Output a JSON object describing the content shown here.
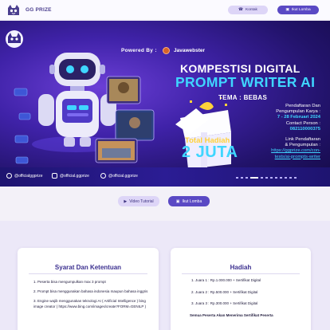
{
  "header": {
    "brand": "GG PRIZE",
    "contact_label": "Kontak",
    "join_label": "Ikut Lomba"
  },
  "banner": {
    "powered_by": "Powered By :",
    "sponsor": "Javawebster",
    "title_line1": "KOMPESTISI DIGITAL",
    "title_line2": "PROMPT WRITER AI",
    "theme": "TEMA : BEBAS",
    "registration_label_1": "Pendaftaran Dan",
    "registration_label_2": "Pengumpulan Karya :",
    "registration_date": "7 - 28 Februari 2024",
    "contact_label": "Contact Person :",
    "contact_number": "082110000375",
    "link_label_1": "Link Pendaftaran",
    "link_label_2": "& Pengumpulan :",
    "link_1": "https://ggprize.com/con-",
    "link_2": "tests/ai-prompts-writer",
    "prize_label": "Total Hadiah",
    "prize_value": "2 JUTA",
    "socials": [
      "@officialggprize",
      "@official.ggprize",
      "@official.ggprize"
    ]
  },
  "actions": {
    "video_label": "Video Tutorial",
    "join_label": "Ikut Lomba"
  },
  "rules_card": {
    "title": "Syarat Dan Ketentuan",
    "items": [
      "1.  Peserta bisa mengumpulkan max 3 prompt",
      "2.  Prompt bisa menggunakan bahasa indonesia maupun bahasa inggris",
      "3.  Engine wajib menggunakan teknologi AI ( Artificial Intelligence ) bing image creator ( https://www.bing.com/images/create?FORM=GENILP )"
    ]
  },
  "prize_card": {
    "title": "Hadiah",
    "items": [
      "1.  Juara 1 : Rp.1.000.000 + Sertifikat Digital",
      "2.  Juara 2 : Rp.500.000 + Sertifikat Digital",
      "3.  Juara 3 : Rp.300.000 + Sertifikat Digital"
    ],
    "note": "Semua Peserta Akan Menerima Sertifikat Peserta"
  },
  "colors": {
    "accent": "#5a49c4",
    "accent_light": "#ddd5f7",
    "banner_cyan": "#3fd6ff",
    "banner_gold": "#ffd23a"
  }
}
